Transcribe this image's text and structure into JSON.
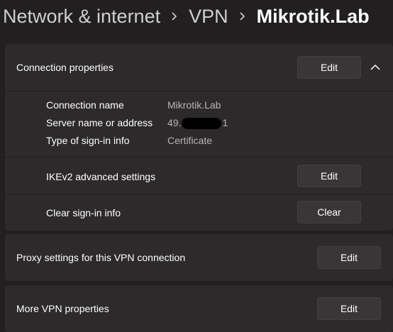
{
  "breadcrumb": {
    "items": [
      "Network & internet",
      "VPN"
    ],
    "current": "Mikrotik.Lab"
  },
  "connection_properties": {
    "title": "Connection properties",
    "edit_label": "Edit",
    "props": {
      "name_label": "Connection name",
      "name_value": "Mikrotik.Lab",
      "server_label": "Server name or address",
      "server_prefix": "49.",
      "server_suffix": "1",
      "signin_type_label": "Type of sign-in info",
      "signin_type_value": "Certificate"
    },
    "ikev2": {
      "label": "IKEv2 advanced settings",
      "button": "Edit"
    },
    "clear_signin": {
      "label": "Clear sign-in info",
      "button": "Clear"
    }
  },
  "proxy": {
    "label": "Proxy settings for this VPN connection",
    "button": "Edit"
  },
  "more": {
    "label": "More VPN properties",
    "button": "Edit"
  },
  "colors": {
    "background": "#221f20",
    "card": "#2d2a2b",
    "button": "#3a3637"
  },
  "icons": {
    "breadcrumb_separator": "chevron-right-icon",
    "collapse": "chevron-up-icon"
  }
}
